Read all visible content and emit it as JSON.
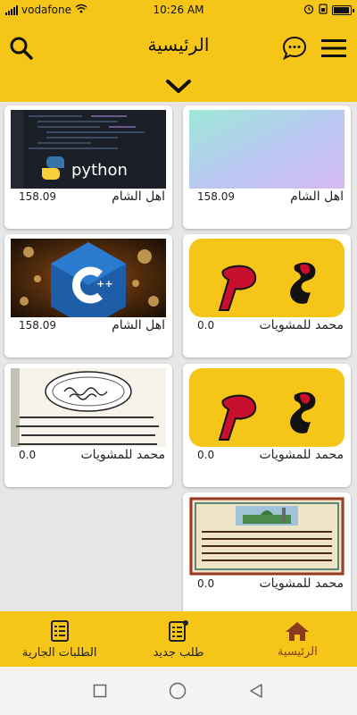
{
  "status": {
    "carrier": "vodafone",
    "time": "10:26 AM",
    "battery_level": 0.95
  },
  "header": {
    "title": "الرئيسية",
    "icons": {
      "search": "search-icon",
      "chat": "chat-bubble-icon",
      "menu": "hamburger-menu-icon",
      "expand": "chevron-down-icon"
    }
  },
  "products": [
    {
      "name": "اهل الشام",
      "price": "158.09",
      "image": "gradient-thumbnail"
    },
    {
      "name": "اهل الشام",
      "price": "158.09",
      "image": "python-logo-thumbnail"
    },
    {
      "name": "محمد للمشويات",
      "price": "0.0",
      "image": "restaurant-logo-thumbnail"
    },
    {
      "name": "اهل الشام",
      "price": "158.09",
      "image": "cpp-logo-thumbnail"
    },
    {
      "name": "محمد للمشويات",
      "price": "0.0",
      "image": "restaurant-logo-thumbnail"
    },
    {
      "name": "محمد للمشويات",
      "price": "0.0",
      "image": "arabic-calligraphy-thumbnail"
    },
    {
      "name": "محمد للمشويات",
      "price": "0.0",
      "image": "arabic-manuscript-thumbnail"
    }
  ],
  "thumb_text": {
    "python": "python",
    "cpp": "++"
  },
  "bottom_nav": {
    "home": "الرئيسية",
    "new_order": "طلب جديد",
    "current_orders": "الطلبات الجارية"
  },
  "colors": {
    "brand_yellow": "#f5c518",
    "active_nav": "#8b3a1e"
  }
}
